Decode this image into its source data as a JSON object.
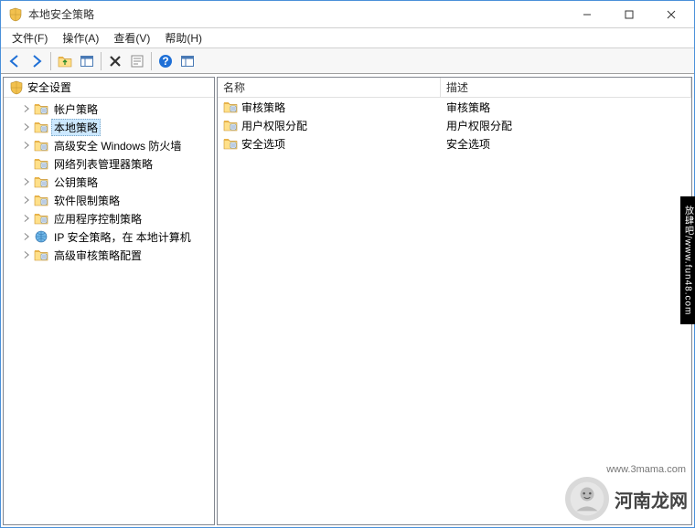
{
  "title": "本地安全策略",
  "menus": {
    "file": "文件(F)",
    "action": "操作(A)",
    "view": "查看(V)",
    "help": "帮助(H)"
  },
  "tree": {
    "root": "安全设置",
    "items": [
      {
        "label": "帐户策略",
        "expandable": true
      },
      {
        "label": "本地策略",
        "expandable": true,
        "selected": true
      },
      {
        "label": "高级安全 Windows 防火墙",
        "expandable": true
      },
      {
        "label": "网络列表管理器策略",
        "expandable": false
      },
      {
        "label": "公钥策略",
        "expandable": true
      },
      {
        "label": "软件限制策略",
        "expandable": true
      },
      {
        "label": "应用程序控制策略",
        "expandable": true
      },
      {
        "label": "IP 安全策略，在 本地计算机",
        "expandable": true,
        "icon": "ip"
      },
      {
        "label": "高级审核策略配置",
        "expandable": true
      }
    ]
  },
  "list": {
    "columns": {
      "name": "名称",
      "desc": "描述"
    },
    "rows": [
      {
        "name": "审核策略",
        "desc": "审核策略"
      },
      {
        "name": "用户权限分配",
        "desc": "用户权限分配"
      },
      {
        "name": "安全选项",
        "desc": "安全选项"
      }
    ]
  },
  "watermarks": {
    "right": "放肆吧/www.fun48.com",
    "bottom_text": "河南龙网",
    "bottom_url": "www.3mama.com"
  }
}
